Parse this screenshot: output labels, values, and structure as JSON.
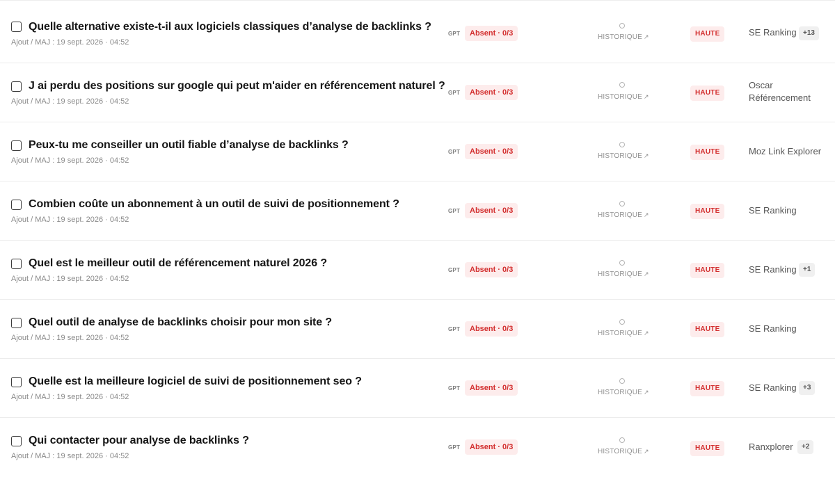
{
  "rows": [
    {
      "question": "Quelle alternative existe-t-il aux logiciels classiques d’analyse de backlinks ?",
      "meta": "Ajout / MAJ : 19 sept. 2026 · 04:52",
      "model": "GPT",
      "status": "Absent · 0/3",
      "history_label": "HISTORIQUE",
      "history_icon": "external-arrow-icon",
      "priority": "HAUTE",
      "competitor": "SE Ranking",
      "extra": "+13"
    },
    {
      "question": "J ai perdu des positions sur google qui peut m'aider en référencement naturel ?",
      "meta": "Ajout / MAJ : 19 sept. 2026 · 04:52",
      "model": "GPT",
      "status": "Absent · 0/3",
      "history_label": "HISTORIQUE",
      "history_icon": "external-arrow-icon",
      "priority": "HAUTE",
      "competitor": "Oscar Référencement",
      "extra": ""
    },
    {
      "question": "Peux-tu me conseiller un outil fiable d’analyse de backlinks ?",
      "meta": "Ajout / MAJ : 19 sept. 2026 · 04:52",
      "model": "GPT",
      "status": "Absent · 0/3",
      "history_label": "HISTORIQUE",
      "history_icon": "external-arrow-icon",
      "priority": "HAUTE",
      "competitor": "Moz Link Explorer",
      "extra": ""
    },
    {
      "question": "Combien coûte un abonnement à un outil de suivi de positionnement ?",
      "meta": "Ajout / MAJ : 19 sept. 2026 · 04:52",
      "model": "GPT",
      "status": "Absent · 0/3",
      "history_label": "HISTORIQUE",
      "history_icon": "external-arrow-icon",
      "priority": "HAUTE",
      "competitor": "SE Ranking",
      "extra": ""
    },
    {
      "question": "Quel est le meilleur outil de référencement naturel 2026 ?",
      "meta": "Ajout / MAJ : 19 sept. 2026 · 04:52",
      "model": "GPT",
      "status": "Absent · 0/3",
      "history_label": "HISTORIQUE",
      "history_icon": "external-arrow-icon",
      "priority": "HAUTE",
      "competitor": "SE Ranking",
      "extra": "+1"
    },
    {
      "question": "Quel outil de analyse de backlinks choisir pour mon site ?",
      "meta": "Ajout / MAJ : 19 sept. 2026 · 04:52",
      "model": "GPT",
      "status": "Absent · 0/3",
      "history_label": "HISTORIQUE",
      "history_icon": "external-arrow-icon",
      "priority": "HAUTE",
      "competitor": "SE Ranking",
      "extra": ""
    },
    {
      "question": "Quelle est la meilleure logiciel de suivi de positionnement seo ?",
      "meta": "Ajout / MAJ : 19 sept. 2026 · 04:52",
      "model": "GPT",
      "status": "Absent · 0/3",
      "history_label": "HISTORIQUE",
      "history_icon": "external-arrow-icon",
      "priority": "HAUTE",
      "competitor": "SE Ranking",
      "extra": "+3"
    },
    {
      "question": "Qui contacter pour analyse de backlinks ?",
      "meta": "Ajout / MAJ : 19 sept. 2026 · 04:52",
      "model": "GPT",
      "status": "Absent · 0/3",
      "history_label": "HISTORIQUE",
      "history_icon": "external-arrow-icon",
      "priority": "HAUTE",
      "competitor": "Ranxplorer",
      "extra": "+2"
    }
  ],
  "colors": {
    "status_text": "#d32f2f",
    "status_bg": "#fdecec",
    "badge_bg": "#f0f0f0",
    "row_border": "#ececec"
  }
}
